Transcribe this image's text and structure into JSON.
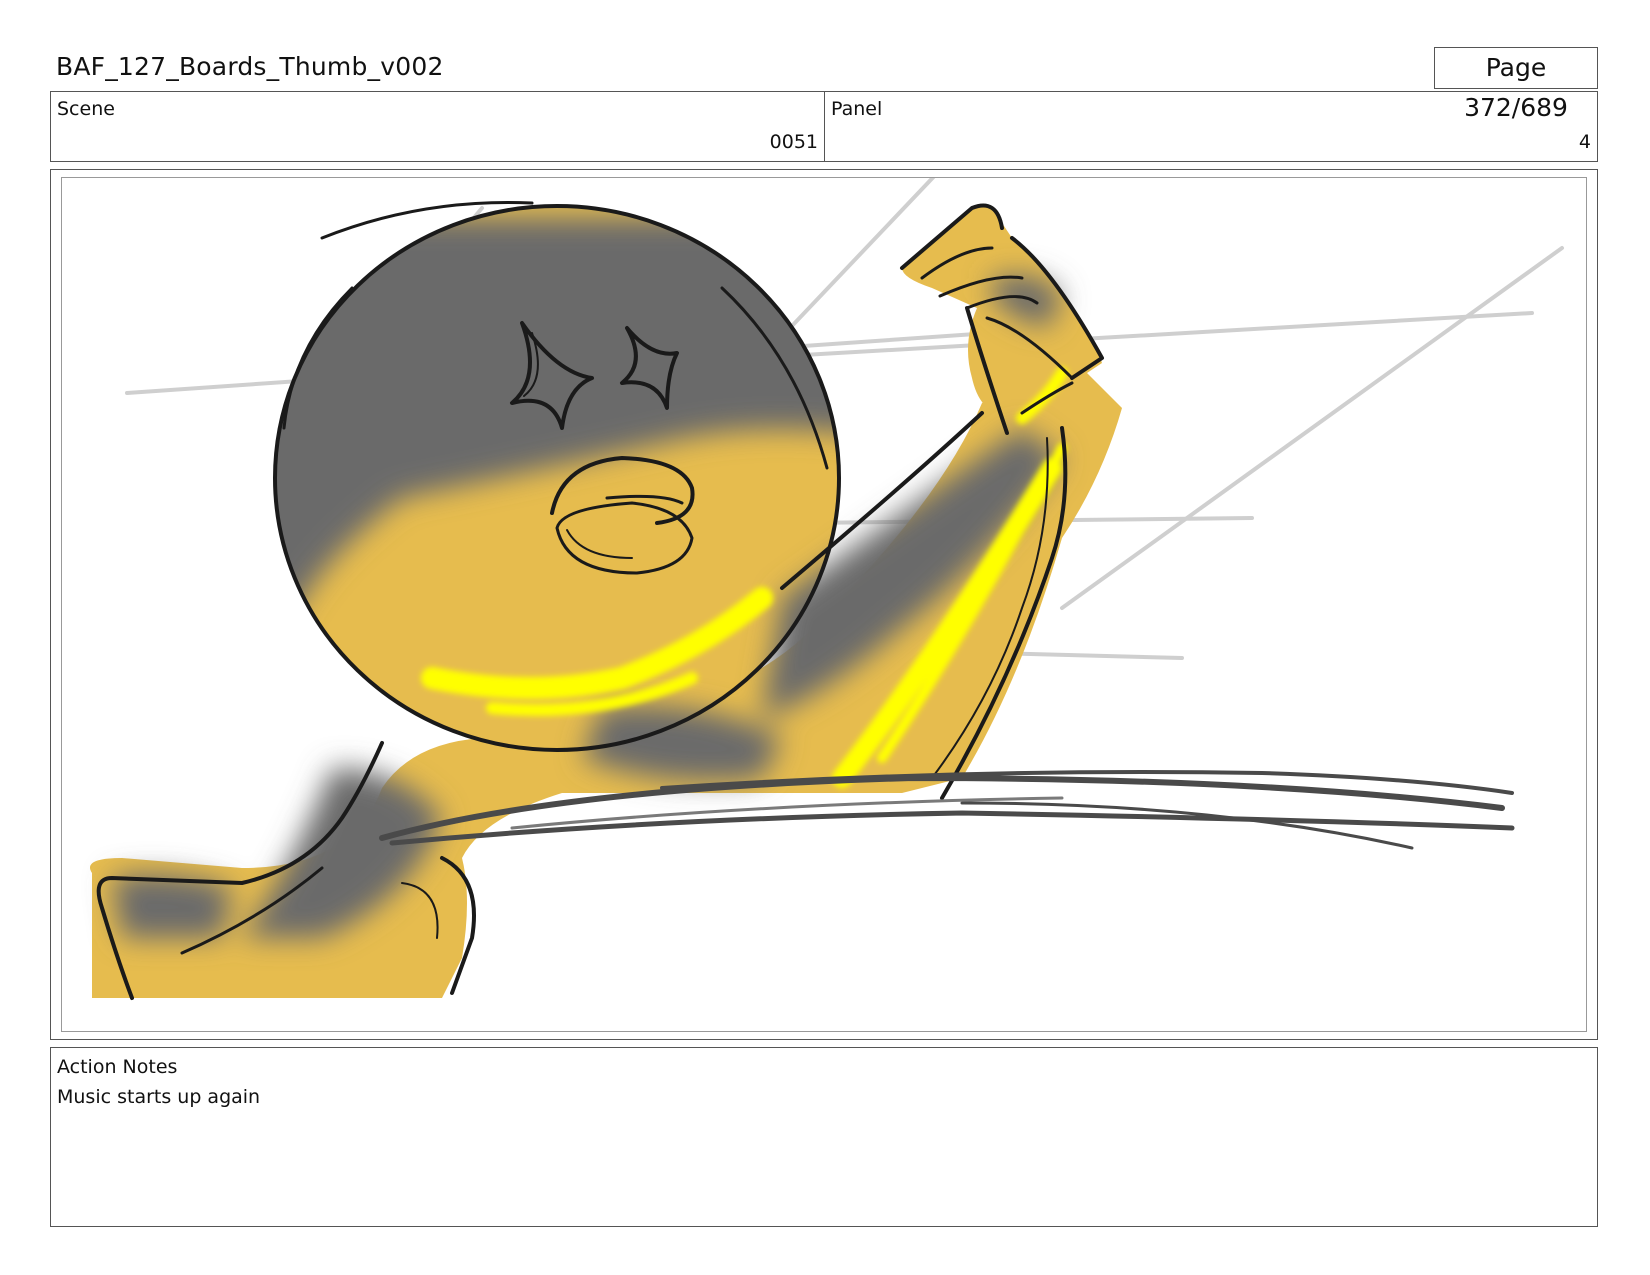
{
  "header": {
    "document_title": "BAF_127_Boards_Thumb_v002",
    "page_label": "Page 372/689"
  },
  "meta": {
    "scene_label": "Scene",
    "scene_value": "0051",
    "panel_label": "Panel",
    "panel_value": "4"
  },
  "notes": {
    "label": "Action Notes",
    "text": "Music starts up again"
  },
  "colors": {
    "character_fill": "#e6bc4e",
    "shadow": "#6a6a6a",
    "highlight": "#ffff00",
    "line": "#1a1a1a"
  }
}
